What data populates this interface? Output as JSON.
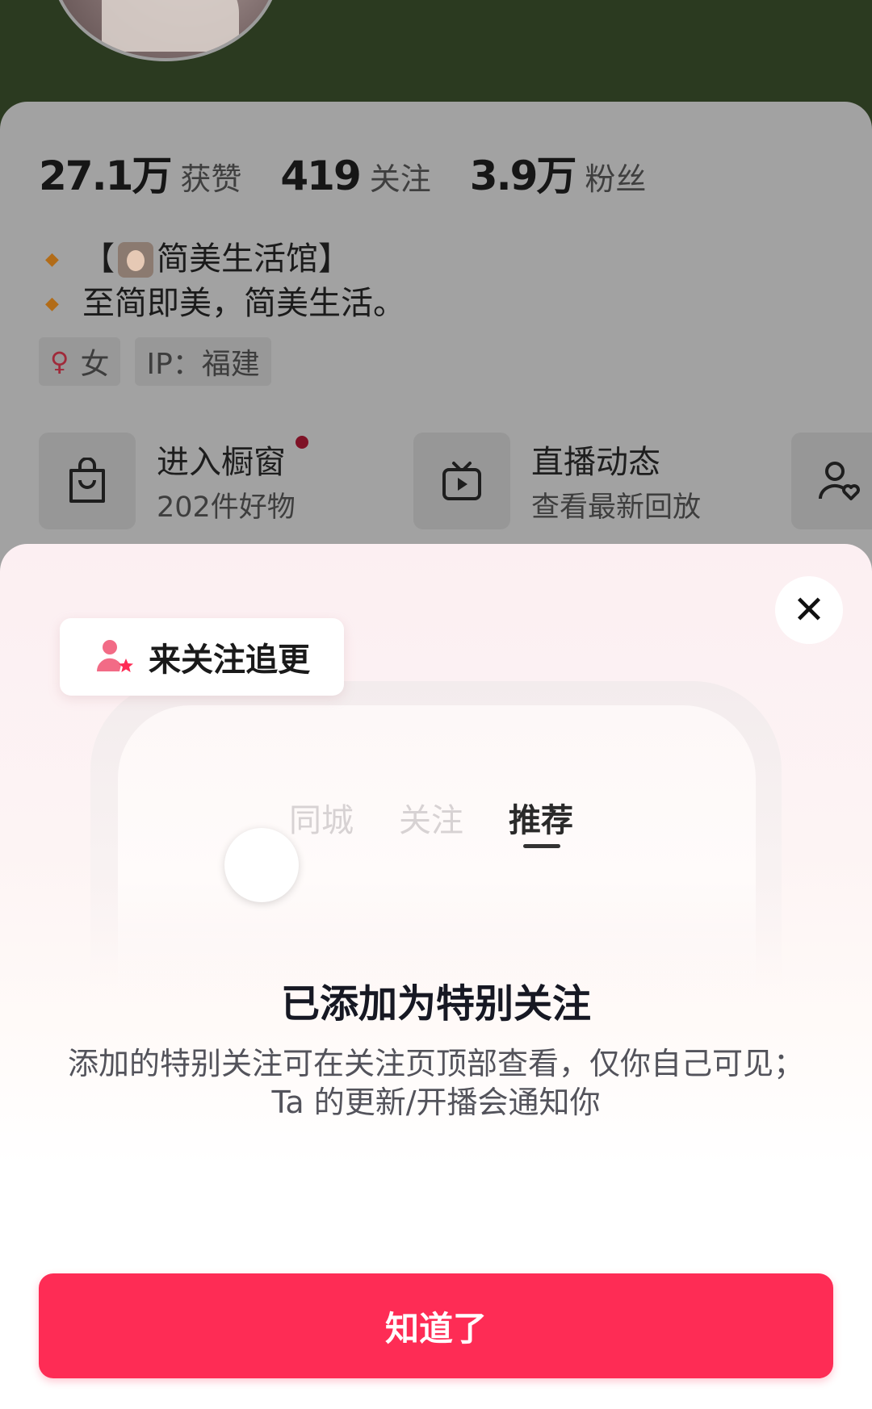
{
  "stats": [
    {
      "value": "27.1万",
      "label": "获赞"
    },
    {
      "value": "419",
      "label": "关注"
    },
    {
      "value": "3.9万",
      "label": "粉丝"
    }
  ],
  "bio": {
    "line1_pre": "【",
    "line1_post": "简美生活馆】",
    "line2": "至简即美，简美生活。"
  },
  "tags": {
    "gender": "女",
    "ip": "IP：福建"
  },
  "shortcuts": [
    {
      "title": "进入橱窗",
      "subtitle": "202件好物"
    },
    {
      "title": "直播动态",
      "subtitle": "查看最新回放"
    }
  ],
  "sheet": {
    "chip_label": "来关注追更",
    "feed_tabs": [
      "同城",
      "关注",
      "推荐"
    ],
    "title": "已添加为特别关注",
    "description": "添加的特别关注可在关注页顶部查看，仅你自己可见；Ta 的更新/开播会通知你",
    "button_label": "知道了"
  },
  "colors": {
    "accent": "#fe2c55",
    "close_icon": "x-icon"
  }
}
